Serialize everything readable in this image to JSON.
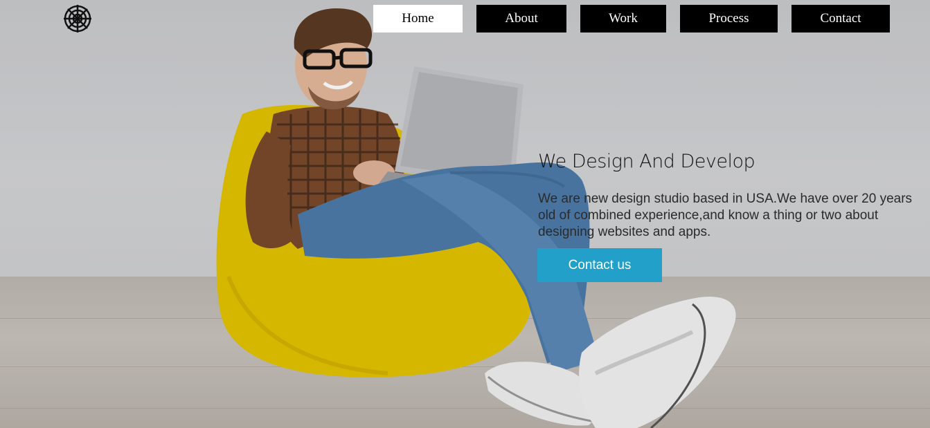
{
  "nav": {
    "items": [
      {
        "label": "Home"
      },
      {
        "label": "About"
      },
      {
        "label": "Work"
      },
      {
        "label": "Process"
      },
      {
        "label": "Contact"
      }
    ],
    "active": "Home"
  },
  "hero": {
    "headline": "We Design And Develop",
    "description": "We are new design studio based in USA.We have over 20 years old of combined experience,and know a thing or two about designing websites and apps.",
    "cta_label": "Contact us"
  },
  "colors": {
    "cta": "#22a0c9",
    "nav_bg": "#000000",
    "nav_active_bg": "#ffffff"
  },
  "icons": {
    "logo": "spider-web-icon"
  }
}
